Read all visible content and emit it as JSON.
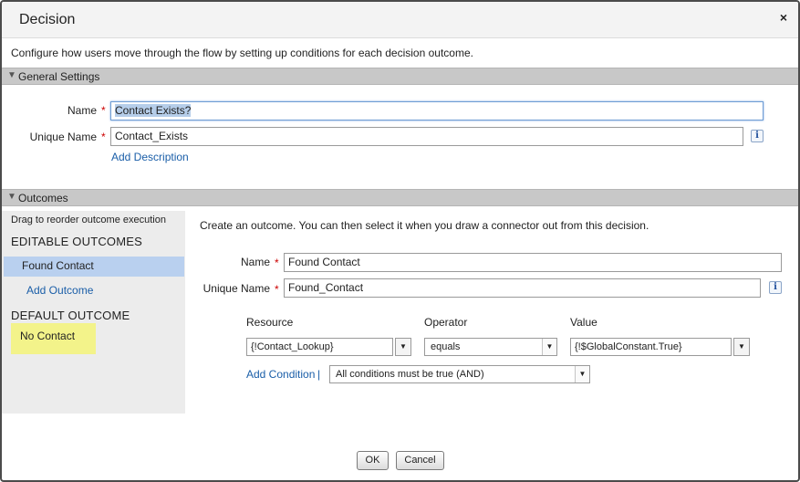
{
  "dialog": {
    "title": "Decision",
    "close_glyph": "×",
    "intro": "Configure how users move through the flow by setting up conditions for each decision outcome."
  },
  "general_settings": {
    "title": "General Settings",
    "name_label": "Name",
    "name_value": "Contact Exists?",
    "unique_name_label": "Unique Name",
    "unique_name_value": "Contact_Exists",
    "add_description": "Add Description",
    "required_glyph": "*",
    "info_glyph": "i"
  },
  "outcomes": {
    "title": "Outcomes",
    "drag_hint": "Drag to reorder outcome execution",
    "editable_heading": "EDITABLE OUTCOMES",
    "editable_items": [
      "Found Contact"
    ],
    "add_outcome": "Add Outcome",
    "default_heading": "DEFAULT OUTCOME",
    "default_item": "No Contact",
    "create_hint": "Create an outcome.  You can then select it when you draw a connector out from this decision.",
    "name_label": "Name",
    "name_value": "Found Contact",
    "unique_name_label": "Unique Name",
    "unique_name_value": "Found_Contact",
    "columns": {
      "resource": "Resource",
      "operator": "Operator",
      "value": "Value"
    },
    "condition": {
      "resource": "{!Contact_Lookup}",
      "operator": "equals",
      "value": "{!$GlobalConstant.True}"
    },
    "add_condition": "Add Condition",
    "separator": "|",
    "logic": "All conditions must be true (AND)"
  },
  "footer": {
    "ok_label": "OK",
    "cancel_label": "Cancel"
  },
  "icons": {
    "collapse": "triangle-down-icon",
    "dropdown": "chevron-down-icon",
    "info": "info-icon"
  },
  "colors": {
    "section_bar": "#c8c8c8",
    "selected_item": "#b9d0ef",
    "default_highlight": "#f3f38a",
    "link": "#1a5ea8",
    "required": "#cc0000"
  }
}
